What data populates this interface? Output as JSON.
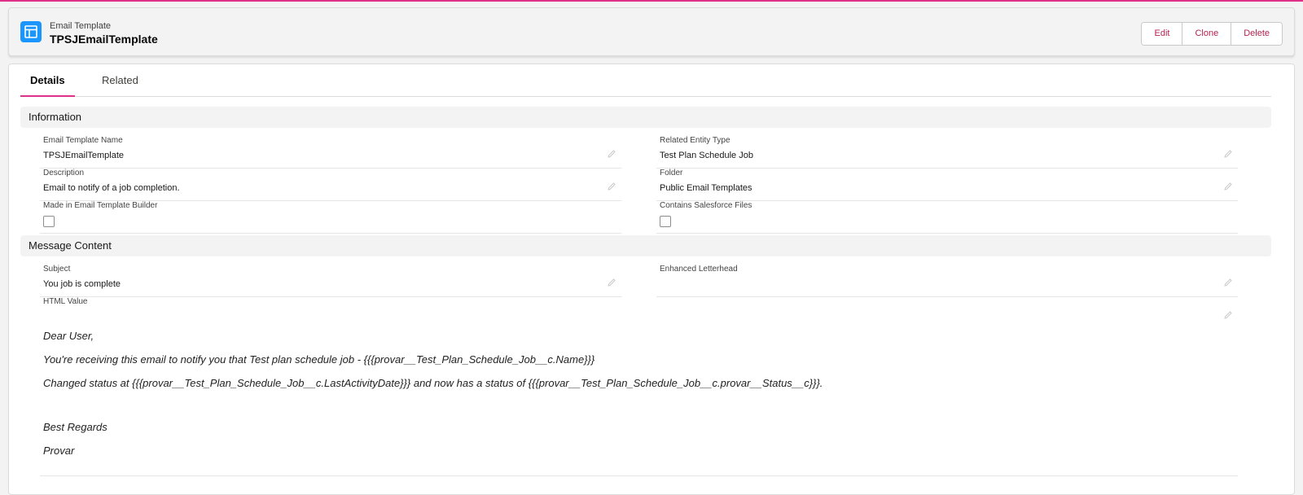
{
  "header": {
    "object_type": "Email Template",
    "record_name": "TPSJEmailTemplate",
    "icon": "email-template-icon",
    "actions": {
      "edit": "Edit",
      "clone": "Clone",
      "delete": "Delete"
    }
  },
  "tabs": {
    "details": "Details",
    "related": "Related"
  },
  "sections": {
    "information": {
      "title": "Information",
      "email_template_name": {
        "label": "Email Template Name",
        "value": "TPSJEmailTemplate"
      },
      "related_entity_type": {
        "label": "Related Entity Type",
        "value": "Test Plan Schedule Job"
      },
      "description": {
        "label": "Description",
        "value": "Email to notify of a job completion."
      },
      "folder": {
        "label": "Folder",
        "value": "Public Email Templates"
      },
      "made_in_builder": {
        "label": "Made in Email Template Builder",
        "checked": false
      },
      "contains_files": {
        "label": "Contains Salesforce Files",
        "checked": false
      }
    },
    "message_content": {
      "title": "Message Content",
      "subject": {
        "label": "Subject",
        "value": "You job is complete"
      },
      "enhanced_letterhead": {
        "label": "Enhanced Letterhead",
        "value": ""
      },
      "html_value": {
        "label": "HTML Value",
        "lines": [
          "Dear User,",
          "You're receiving this email to notify you that Test plan schedule job - {{{provar__Test_Plan_Schedule_Job__c.Name}}}",
          "Changed status at  {{{provar__Test_Plan_Schedule_Job__c.LastActivityDate}}} and now has a status of {{{provar__Test_Plan_Schedule_Job__c.provar__Status__c}}}.",
          "Best Regards",
          "Provar"
        ]
      }
    }
  },
  "colors": {
    "accent": "#e0318a",
    "icon_bg": "#1b96ff",
    "button_text": "#b4234f"
  }
}
